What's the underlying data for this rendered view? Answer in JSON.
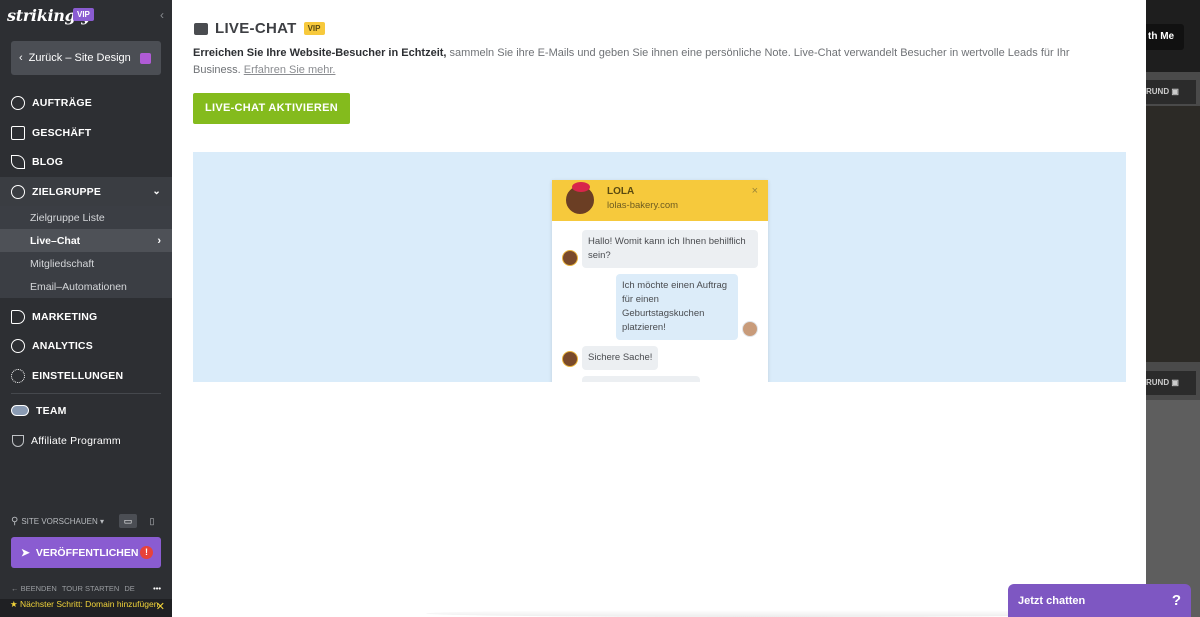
{
  "sidebar": {
    "brand": "strikingly",
    "brand_badge": "VIP",
    "back_label": "Zurück – Site Design",
    "nav": [
      {
        "label": "AUFTRÄGE",
        "icon": "dollar-circle-icon"
      },
      {
        "label": "GESCHÄFT",
        "icon": "store-icon"
      },
      {
        "label": "BLOG",
        "icon": "feather-icon"
      },
      {
        "label": "ZIELGRUPPE",
        "icon": "people-icon"
      }
    ],
    "sub_items": [
      {
        "label": "Zielgruppe Liste"
      },
      {
        "label": "Live–Chat"
      },
      {
        "label": "Mitgliedschaft"
      },
      {
        "label": "Email–Automationen"
      }
    ],
    "nav2": [
      {
        "label": "MARKETING",
        "icon": "megaphone-icon"
      },
      {
        "label": "ANALYTICS",
        "icon": "pie-chart-icon"
      },
      {
        "label": "EINSTELLUNGEN",
        "icon": "gear-icon"
      },
      {
        "label": "TEAM",
        "icon": "team-icon"
      },
      {
        "label": "Affiliate Programm",
        "icon": "trophy-icon"
      }
    ],
    "preview_label": "SITE VORSCHAUEN ▾",
    "publish_label": "VERÖFFENTLICHEN",
    "footer": {
      "end": "← BEENDEN",
      "tour": "TOUR STARTEN",
      "lang": "DE",
      "more": "•••"
    },
    "next_step": "Nächster Schritt: Domain hinzufügen"
  },
  "editor_bg": {
    "button": "th Me",
    "tag_1": "RUND ▣",
    "tag_2": "RUND ▣"
  },
  "panel": {
    "title": "LIVE-CHAT",
    "badge": "VIP",
    "desc_bold": "Erreichen Sie Ihre Website-Besucher in Echtzeit,",
    "desc_text": " sammeln Sie ihre E-Mails und geben Sie ihnen eine persönliche Note. Live-Chat verwandelt Besucher in wertvolle Leads für Ihr Business. ",
    "desc_link": "Erfahren Sie mehr.",
    "activate_label": "LIVE-CHAT AKTIVIEREN",
    "chat_preview": {
      "agent_name": "LOLA",
      "agent_site": "lolas-bakery.com",
      "close": "×",
      "messages": [
        {
          "from": "agent",
          "text": "Hallo! Womit kann ich Ihnen behilflich sein?"
        },
        {
          "from": "user",
          "text": "Ich möchte einen Auftrag für einen Geburtstagskuchen platzieren!"
        },
        {
          "from": "agent",
          "text": "Sichere Sache!"
        }
      ]
    }
  },
  "launcher": {
    "label": "Jetzt chatten",
    "help": "?"
  },
  "colors": {
    "accent_purple": "#8a5cd1",
    "activate_green": "#84bb1d",
    "chat_yellow": "#f6c93c",
    "launcher_purple": "#7e57c2"
  }
}
